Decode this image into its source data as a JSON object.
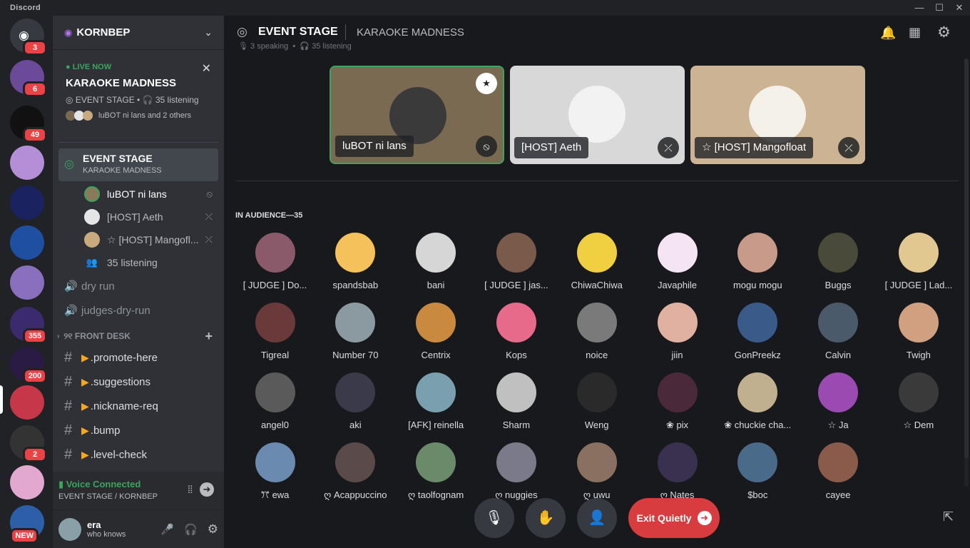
{
  "app": {
    "name": "Discord"
  },
  "window_controls": {
    "minimize": "—",
    "maximize": "☐",
    "close": "✕"
  },
  "rail": {
    "servers": [
      {
        "name": "Home",
        "badge": "3",
        "color": "#36393f"
      },
      {
        "name": "server-anime",
        "badge": "6",
        "color": "#6b4a9a"
      },
      {
        "name": "server-rm",
        "badge": "49",
        "color": "#111"
      },
      {
        "name": "server-gate",
        "badge": "",
        "color": "#b48ed6"
      },
      {
        "name": "server-city",
        "badge": "",
        "color": "#1a2260"
      },
      {
        "name": "server-blue",
        "badge": "",
        "color": "#1e4fa0"
      },
      {
        "name": "server-basta",
        "badge": "",
        "color": "#8a6fbf"
      },
      {
        "name": "server-355",
        "badge": "355",
        "color": "#3b2a6e"
      },
      {
        "name": "server-bisaya",
        "badge": "200",
        "color": "#2a1b45"
      },
      {
        "name": "server-kornbep",
        "badge": "",
        "color": "#c7374a"
      },
      {
        "name": "server-dark",
        "badge": "2",
        "color": "#333"
      },
      {
        "name": "server-pink",
        "badge": "",
        "color": "#e3a8d0"
      },
      {
        "name": "server-new",
        "badge": "NEW",
        "color": "#2d5fa8"
      }
    ]
  },
  "sidebar": {
    "server_name": "KORNBEP",
    "live": {
      "status": "LIVE NOW",
      "title": "KARAOKE MADNESS",
      "sub": "EVENT STAGE • 🎧 35 listening",
      "people": "luBOT ni lans and 2 others"
    },
    "active_channel": {
      "name": "EVENT STAGE",
      "topic": "KARAOKE MADNESS"
    },
    "stage_users": [
      {
        "name": "luBOT ni lans",
        "color": "#8a7a5a",
        "bright": true
      },
      {
        "name": "[HOST] Aeth",
        "color": "#e5e5e5",
        "bright": false
      },
      {
        "name": "☆ [HOST] Mangofl...",
        "color": "#c9a97e",
        "bright": false
      }
    ],
    "listening": "35 listening",
    "voice_channels": [
      "dry run",
      "judges-dry-run"
    ],
    "category": "୨୧ FRONT DESK",
    "text_channels": [
      ".promote-here",
      ".suggestions",
      ".nickname-req",
      ".bump",
      ".level-check"
    ],
    "voice_status": {
      "title": "Voice Connected",
      "location": "EVENT STAGE / KORNBEP"
    },
    "user": {
      "name": "era",
      "status": "who knows"
    }
  },
  "main": {
    "title": "EVENT STAGE",
    "topic": "KARAOKE MADNESS",
    "meta_speaking": "3 speaking",
    "meta_listening": "35 listening",
    "speakers": [
      {
        "name": "luBOT ni lans",
        "bg": "#7a6a52",
        "av": "#3a3a3a",
        "active": true
      },
      {
        "name": "[HOST] Aeth",
        "bg": "#d8d8d8",
        "av": "#f2f2f2",
        "active": false
      },
      {
        "name": "☆ [HOST] Mangofloat",
        "bg": "#cbb394",
        "av": "#f4f0ea",
        "active": false
      }
    ],
    "audience_title": "IN AUDIENCE—35",
    "audience": [
      {
        "name": "[ JUDGE ] Do...",
        "color": "#8a5a6a"
      },
      {
        "name": "spandsbab",
        "color": "#f5c15a"
      },
      {
        "name": "bani",
        "color": "#d6d6d6"
      },
      {
        "name": "[ JUDGE ] jas...",
        "color": "#7a5a4a"
      },
      {
        "name": "ChiwaChiwa",
        "color": "#f0d040"
      },
      {
        "name": "Javaphile",
        "color": "#f4e4f4"
      },
      {
        "name": "mogu mogu",
        "color": "#c89a8a"
      },
      {
        "name": "Buggs",
        "color": "#4a4a3a"
      },
      {
        "name": "[ JUDGE ] Lad...",
        "color": "#e0c890"
      },
      {
        "name": "Tigreal",
        "color": "#6a3a3a"
      },
      {
        "name": "Number 70",
        "color": "#8a9aa0"
      },
      {
        "name": "Centrix",
        "color": "#c98a40"
      },
      {
        "name": "Kops",
        "color": "#e86a8a"
      },
      {
        "name": "noice",
        "color": "#7a7a7a"
      },
      {
        "name": "jiin",
        "color": "#e0b0a0"
      },
      {
        "name": "GonPreekz",
        "color": "#3a5a8a"
      },
      {
        "name": "Calvin",
        "color": "#4a5a6a"
      },
      {
        "name": "Twigh",
        "color": "#d0a080"
      },
      {
        "name": "angel0",
        "color": "#5a5a5a"
      },
      {
        "name": "aki",
        "color": "#3a3a4a"
      },
      {
        "name": "[AFK] reinella",
        "color": "#7aa0b0"
      },
      {
        "name": "Sharm",
        "color": "#c0c0c0"
      },
      {
        "name": "Weng",
        "color": "#2a2a2a"
      },
      {
        "name": "❀ pix",
        "color": "#4a2a3a"
      },
      {
        "name": "❀ chuckie cha...",
        "color": "#c0b090"
      },
      {
        "name": "☆ Ja",
        "color": "#9a4ab0"
      },
      {
        "name": "☆ Dem",
        "color": "#3a3a3a"
      },
      {
        "name": "ꔫ ewa",
        "color": "#6a8ab0"
      },
      {
        "name": "ღ Acappuccino",
        "color": "#5a4a4a"
      },
      {
        "name": "ღ taolfognam",
        "color": "#6a8a6a"
      },
      {
        "name": "ღ nuggies",
        "color": "#7a7a8a"
      },
      {
        "name": "ღ uwu",
        "color": "#8a7060"
      },
      {
        "name": "ღ Nates",
        "color": "#3a3050"
      },
      {
        "name": "$boc",
        "color": "#4a6a8a"
      },
      {
        "name": "cayee",
        "color": "#8a5a4a"
      }
    ],
    "controls": {
      "exit": "Exit Quietly"
    }
  }
}
